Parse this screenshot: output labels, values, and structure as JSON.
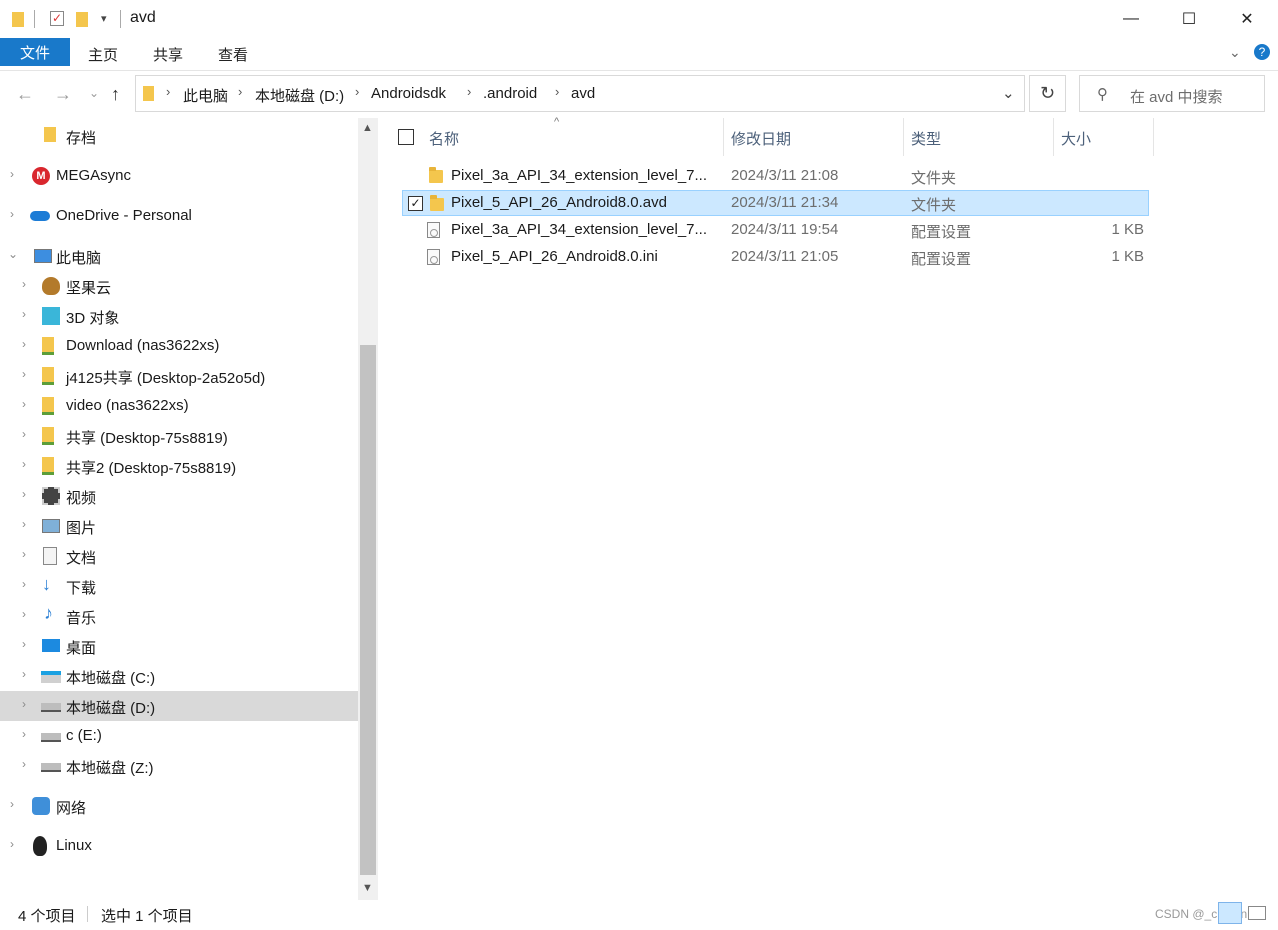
{
  "window": {
    "title": "avd",
    "controls": {
      "minimize": "—",
      "maximize": "☐",
      "close": "✕"
    }
  },
  "ribbon": {
    "file_tab": "文件",
    "tabs": [
      "主页",
      "共享",
      "查看"
    ]
  },
  "address": {
    "breadcrumbs": [
      "此电脑",
      "本地磁盘 (D:)",
      "Androidsdk",
      ".android",
      "avd"
    ],
    "search_placeholder": "在 avd 中搜索"
  },
  "sidebar": {
    "items": [
      {
        "label": "存档",
        "icon": "folder-icon"
      },
      {
        "label": "MEGAsync",
        "icon": "mega-icon"
      },
      {
        "label": "OneDrive - Personal",
        "icon": "onedrive-icon"
      },
      {
        "label": "此电脑",
        "icon": "computer-icon"
      },
      {
        "label": "坚果云",
        "icon": "nutstore-icon"
      },
      {
        "label": "3D 对象",
        "icon": "3d-objects-icon"
      },
      {
        "label": "Download (nas3622xs)",
        "icon": "network-folder-icon"
      },
      {
        "label": "j4125共享 (Desktop-2a52o5d)",
        "icon": "network-folder-icon"
      },
      {
        "label": "video (nas3622xs)",
        "icon": "network-folder-icon"
      },
      {
        "label": "共享 (Desktop-75s8819)",
        "icon": "network-folder-icon"
      },
      {
        "label": "共享2 (Desktop-75s8819)",
        "icon": "network-folder-icon"
      },
      {
        "label": "视频",
        "icon": "videos-icon"
      },
      {
        "label": "图片",
        "icon": "pictures-icon"
      },
      {
        "label": "文档",
        "icon": "documents-icon"
      },
      {
        "label": "下载",
        "icon": "downloads-icon"
      },
      {
        "label": "音乐",
        "icon": "music-icon"
      },
      {
        "label": "桌面",
        "icon": "desktop-icon"
      },
      {
        "label": "本地磁盘 (C:)",
        "icon": "windows-drive-icon"
      },
      {
        "label": "本地磁盘 (D:)",
        "icon": "drive-icon"
      },
      {
        "label": "c (E:)",
        "icon": "drive-icon"
      },
      {
        "label": "本地磁盘 (Z:)",
        "icon": "drive-icon"
      },
      {
        "label": "网络",
        "icon": "network-icon"
      },
      {
        "label": "Linux",
        "icon": "linux-icon"
      }
    ]
  },
  "columns": {
    "name": "名称",
    "modified": "修改日期",
    "type": "类型",
    "size": "大小"
  },
  "files": [
    {
      "name": "Pixel_3a_API_34_extension_level_7...",
      "modified": "2024/3/11 21:08",
      "type": "文件夹",
      "size": "",
      "kind": "folder"
    },
    {
      "name": "Pixel_5_API_26_Android8.0.avd",
      "modified": "2024/3/11 21:34",
      "type": "文件夹",
      "size": "",
      "kind": "folder"
    },
    {
      "name": "Pixel_3a_API_34_extension_level_7...",
      "modified": "2024/3/11 19:54",
      "type": "配置设置",
      "size": "1 KB",
      "kind": "ini"
    },
    {
      "name": "Pixel_5_API_26_Android8.0.ini",
      "modified": "2024/3/11 21:05",
      "type": "配置设置",
      "size": "1 KB",
      "kind": "ini"
    }
  ],
  "status": {
    "count": "4 个项目",
    "selected": "选中 1 个项目"
  },
  "watermark": "CSDN @_chaton",
  "colors": {
    "accent": "#1979ca",
    "selection": "#cce8ff"
  }
}
